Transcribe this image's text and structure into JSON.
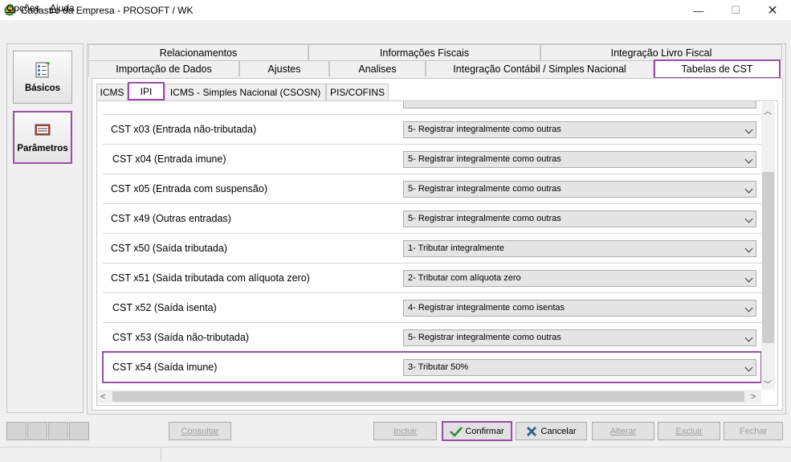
{
  "window": {
    "title": "Cadastro da Empresa - PROSOFT / WK",
    "min_glyph": "—",
    "max_glyph": "☐",
    "close_glyph": "✕"
  },
  "menu": {
    "opcoes_first": "O",
    "opcoes_rest": "pções",
    "ajuda_first": "A",
    "ajuda_rest": "juda"
  },
  "sidebar": {
    "basicos": "Básicos",
    "parametros": "Parâmetros"
  },
  "tabs": {
    "row1": [
      "Relacionamentos",
      "Informações Fiscais",
      "Integração Livro Fiscal"
    ],
    "row2": [
      "Importação de Dados",
      "Ajustes",
      "Analises",
      "Integração Contábil / Simples Nacional",
      "Tabelas de CST"
    ]
  },
  "subtabs": [
    "ICMS",
    "IPI",
    "ICMS - Simples Nacional (CSOSN)",
    "PIS/COFINS"
  ],
  "rows": [
    {
      "label": "CST x03 (Entrada não-tributada)",
      "value": "5- Registrar integralmente como outras"
    },
    {
      "label": "CST x04 (Entrada imune)",
      "value": "5- Registrar integralmente como outras"
    },
    {
      "label": "CST x05 (Entrada com suspensão)",
      "value": "5- Registrar integralmente como outras"
    },
    {
      "label": "CST x49 (Outras entradas)",
      "value": "5- Registrar integralmente como outras"
    },
    {
      "label": "CST x50 (Saída tributada)",
      "value": "1- Tributar integralmente"
    },
    {
      "label": "CST x51 (Saída tributada com alíquota zero)",
      "value": "2- Tributar com alíquota zero"
    },
    {
      "label": "CST x52 (Saída isenta)",
      "value": "4- Registrar integralmente como isentas"
    },
    {
      "label": "CST x53 (Saída não-tributada)",
      "value": "5- Registrar integralmente como outras"
    },
    {
      "label": "CST x54 (Saída imune)",
      "value": "3- Tributar 50%"
    }
  ],
  "buttons": {
    "consultar": "Consultar",
    "incluir": "Incluir",
    "confirmar": "Confirmar",
    "cancelar": "Cancelar",
    "alterar": "Alterar",
    "excluir": "Excluir",
    "fechar": "Fechar"
  },
  "colors": {
    "highlight": "#9b4ea8",
    "confirm_check": "#2e8b2e",
    "cancel_x": "#2a5f8a"
  }
}
